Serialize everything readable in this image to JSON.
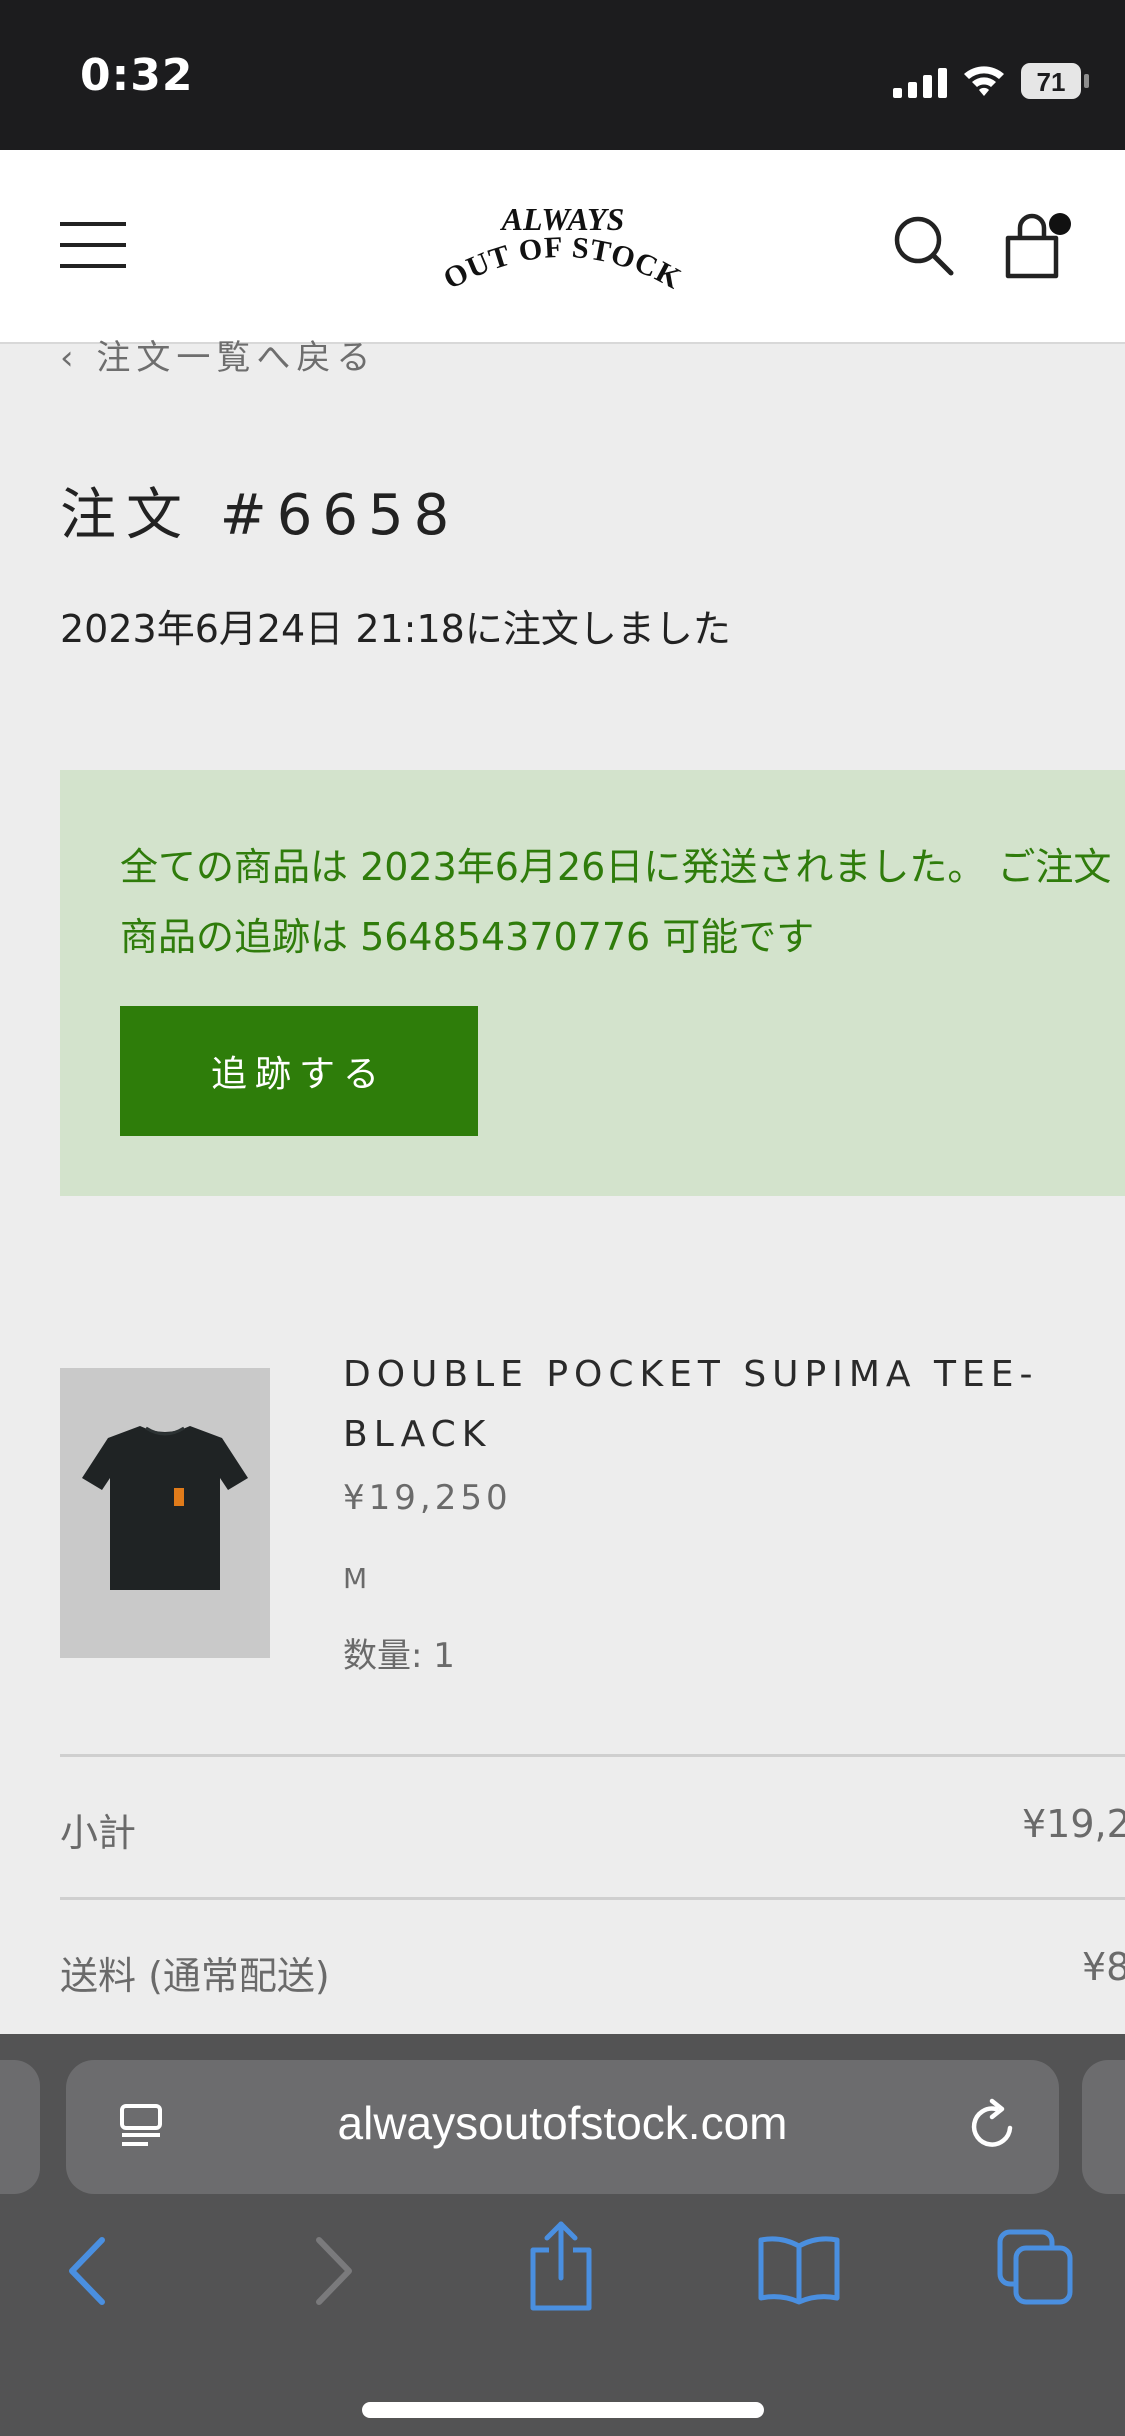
{
  "status_bar": {
    "time": "0:32",
    "battery": "71"
  },
  "header": {
    "logo_line1": "ALWAYS",
    "logo_line2": "OUT OF STOCK",
    "menu_icon": "hamburger-menu-icon",
    "search_icon": "search-icon",
    "cart_icon": "cart-icon"
  },
  "order": {
    "back_label": "注文一覧へ戻る",
    "title": "注文 #6658",
    "date": "2023年6月24日 21:18に注文しました"
  },
  "shipping_notice": {
    "message": "全ての商品は 2023年6月26日に発送されました。 ご注文商品の追跡は 564854370776 可能です",
    "track_button": "追跡する"
  },
  "line_items": [
    {
      "name": "DOUBLE POCKET SUPIMA TEE-BLACK",
      "price": "¥19,250",
      "variant": "M",
      "quantity_label": "数量: 1"
    }
  ],
  "summary": [
    {
      "label": "小計",
      "value": "¥19,2"
    },
    {
      "label": "送料 (通常配送)",
      "value": "¥8"
    }
  ],
  "browser": {
    "url": "alwaysoutofstock.com"
  },
  "colors": {
    "accent_green": "#2e7d0a",
    "notice_bg": "#d3e3cc",
    "notice_text": "#2f7c0b",
    "safari_blue": "#4a8fe0"
  }
}
